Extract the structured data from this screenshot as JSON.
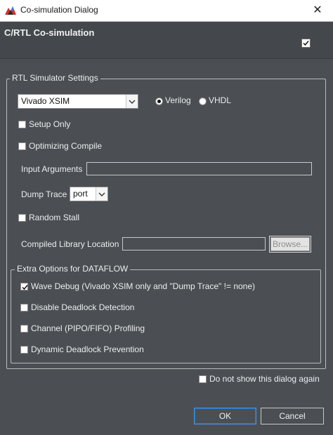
{
  "window": {
    "title": "Co-simulation Dialog",
    "close_label": "✕"
  },
  "header": {
    "title": "C/RTL Co-simulation",
    "checkbox_checked": true
  },
  "rtl_settings": {
    "legend": "RTL Simulator Settings",
    "simulator": {
      "value": "Vivado XSIM"
    },
    "language": {
      "verilog_label": "Verilog",
      "vhdl_label": "VHDL",
      "selected": "Verilog"
    },
    "setup_only_label": "Setup Only",
    "optimizing_compile_label": "Optimizing Compile",
    "input_arguments_label": "Input Arguments",
    "input_arguments_value": "",
    "dump_trace_label": "Dump Trace",
    "dump_trace_value": "port",
    "random_stall_label": "Random Stall",
    "compiled_library_label": "Compiled Library Location",
    "compiled_library_value": "",
    "browse_label": "Browse..."
  },
  "extra_options": {
    "legend": "Extra Options for DATAFLOW",
    "items": [
      {
        "label": "Wave Debug (Vivado XSIM only and \"Dump Trace\" != none)",
        "checked": true
      },
      {
        "label": "Disable Deadlock Detection",
        "checked": false
      },
      {
        "label": "Channel (PIPO/FIFO) Profiling",
        "checked": false
      },
      {
        "label": "Dynamic Deadlock Prevention",
        "checked": false
      }
    ]
  },
  "footer": {
    "do_not_show_label": "Do not show this dialog again",
    "ok_label": "OK",
    "cancel_label": "Cancel"
  },
  "colors": {
    "background": "#4b4f53",
    "accent": "#4a90d9",
    "text": "#ececec"
  }
}
